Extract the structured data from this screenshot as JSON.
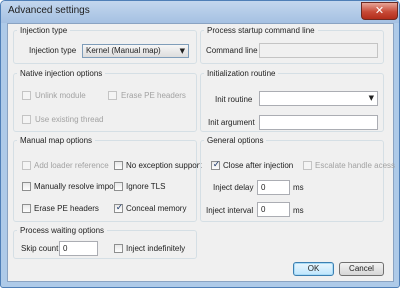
{
  "window": {
    "title": "Advanced settings",
    "close_glyph": "✕"
  },
  "injection_type": {
    "group_label": "Injection type",
    "label": "Injection type",
    "selected": "Kernel (Manual map)"
  },
  "process_startup": {
    "group_label": "Process startup command line",
    "command_line_label": "Command line",
    "command_line_value": ""
  },
  "native_options": {
    "group_label": "Native injection options",
    "unlink_module": {
      "label": "Unlink module",
      "checked": false,
      "enabled": false
    },
    "erase_pe_headers": {
      "label": "Erase PE headers",
      "checked": false,
      "enabled": false
    },
    "use_existing_thread": {
      "label": "Use existing thread",
      "checked": false,
      "enabled": false
    }
  },
  "initialization": {
    "group_label": "Initialization routine",
    "init_routine_label": "Init routine",
    "init_routine_value": "",
    "init_argument_label": "Init argument",
    "init_argument_value": ""
  },
  "manual_map": {
    "group_label": "Manual map options",
    "add_loader_reference": {
      "label": "Add loader reference",
      "checked": false,
      "enabled": false
    },
    "no_exception_support": {
      "label": "No exception support",
      "checked": false,
      "enabled": true
    },
    "manually_resolve_imports": {
      "label": "Manually resolve imports",
      "checked": false,
      "enabled": true
    },
    "ignore_tls": {
      "label": "Ignore TLS",
      "checked": false,
      "enabled": true
    },
    "erase_pe_headers": {
      "label": "Erase PE headers",
      "checked": false,
      "enabled": true
    },
    "conceal_memory": {
      "label": "Conceal memory",
      "checked": true,
      "enabled": true
    }
  },
  "general": {
    "group_label": "General options",
    "close_after_injection": {
      "label": "Close after injection",
      "checked": true,
      "enabled": true
    },
    "escalate_handle_access": {
      "label": "Escalate handle acess",
      "checked": false,
      "enabled": false
    },
    "inject_delay_label": "Inject delay",
    "inject_delay_value": "0",
    "inject_delay_unit": "ms",
    "inject_interval_label": "Inject interval",
    "inject_interval_value": "0",
    "inject_interval_unit": "ms"
  },
  "process_waiting": {
    "group_label": "Process waiting options",
    "skip_count_label": "Skip count",
    "skip_count_value": "0",
    "inject_indefinitely": {
      "label": "Inject indefinitely",
      "checked": false,
      "enabled": true
    }
  },
  "buttons": {
    "ok": "OK",
    "cancel": "Cancel"
  },
  "check_glyph": "✓",
  "dropdown_glyph": "▼"
}
